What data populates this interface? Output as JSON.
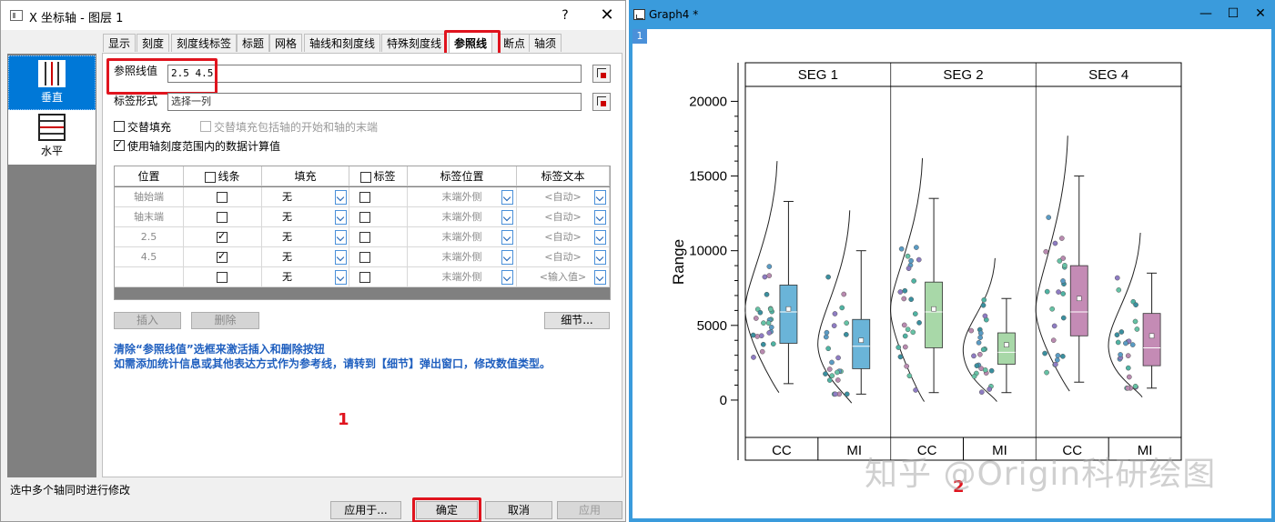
{
  "dialog": {
    "title": "X 坐标轴 - 图层 1",
    "help_label": "?",
    "close_label": "✕",
    "side_nav": [
      {
        "label": "垂直",
        "selected": true
      },
      {
        "label": "水平",
        "selected": false
      }
    ],
    "tabs": [
      "显示",
      "刻度",
      "刻度线标签",
      "标题",
      "网格",
      "轴线和刻度线",
      "特殊刻度线",
      "参照线",
      "断点",
      "轴须"
    ],
    "active_tab": "参照线",
    "ref_values_label": "参照线值",
    "ref_values_value": "2.5 4.5",
    "label_format_label": "标签形式",
    "label_format_value": "选择一列",
    "alt_fill_label": "交替填充",
    "alt_fill_include_label": "交替填充包括轴的开始和轴的末端",
    "use_tick_range_label": "使用轴刻度范围内的数据计算值",
    "table": {
      "headers": [
        "位置",
        "线条",
        "填充",
        "标签",
        "标签位置",
        "标签文本"
      ],
      "rows": [
        {
          "position": "轴始端",
          "line": false,
          "fill": "无",
          "label": false,
          "label_pos": "末端外侧",
          "label_text": "<自动>"
        },
        {
          "position": "轴末端",
          "line": false,
          "fill": "无",
          "label": false,
          "label_pos": "末端外侧",
          "label_text": "<自动>"
        },
        {
          "position": "2.5",
          "line": true,
          "fill": "无",
          "label": false,
          "label_pos": "末端外侧",
          "label_text": "<自动>"
        },
        {
          "position": "4.5",
          "line": true,
          "fill": "无",
          "label": false,
          "label_pos": "末端外侧",
          "label_text": "<自动>"
        },
        {
          "position": "",
          "line": false,
          "fill": "无",
          "label": false,
          "label_pos": "末端外侧",
          "label_text": "<输入值>"
        }
      ]
    },
    "insert_label": "插入",
    "delete_label": "删除",
    "detail_label": "细节...",
    "info_line1": "清除“参照线值”选框来激活插入和删除按钮",
    "info_line2": "如需添加统计信息或其他表达方式作为参考线，请转到【细节】弹出窗口，修改数值类型。",
    "marker1": "1",
    "status": "选中多个轴同时进行修改",
    "apply_to_label": "应用于...",
    "ok_label": "确定",
    "cancel_label": "取消",
    "apply_label": "应用"
  },
  "graph_window": {
    "title": "Graph4 *",
    "layer_badge": "1",
    "minimize": "—",
    "maximize": "☐",
    "close": "✕",
    "marker2": "2"
  },
  "watermark": "知乎 @Origin科研绘图",
  "chart_data": {
    "type": "box",
    "ylabel": "Range",
    "ylim": [
      -2500,
      21000
    ],
    "yticks": [
      0,
      5000,
      10000,
      15000,
      20000
    ],
    "panels": [
      "SEG 1",
      "SEG 2",
      "SEG 4"
    ],
    "categories": [
      "CC",
      "MI"
    ],
    "boxes": [
      {
        "panel": "SEG 1",
        "group": "CC",
        "whisker_low": 1100,
        "q1": 3800,
        "median": 5900,
        "q3": 7700,
        "whisker_high": 13300,
        "mean": 6100,
        "color": "#6ab4d8"
      },
      {
        "panel": "SEG 1",
        "group": "MI",
        "whisker_low": 400,
        "q1": 2100,
        "median": 3600,
        "q3": 5400,
        "whisker_high": 10000,
        "mean": 4000,
        "color": "#6ab4d8"
      },
      {
        "panel": "SEG 2",
        "group": "CC",
        "whisker_low": 500,
        "q1": 3500,
        "median": 5900,
        "q3": 7900,
        "whisker_high": 13500,
        "mean": 6100,
        "color": "#a8d8a8"
      },
      {
        "panel": "SEG 2",
        "group": "MI",
        "whisker_low": 500,
        "q1": 2400,
        "median": 3200,
        "q3": 4500,
        "whisker_high": 6800,
        "mean": 3700,
        "color": "#a8d8a8"
      },
      {
        "panel": "SEG 4",
        "group": "CC",
        "whisker_low": 1200,
        "q1": 4300,
        "median": 5900,
        "q3": 9000,
        "whisker_high": 15000,
        "mean": 6800,
        "color": "#c48bb5"
      },
      {
        "panel": "SEG 4",
        "group": "MI",
        "whisker_low": 800,
        "q1": 2300,
        "median": 3500,
        "q3": 5800,
        "whisker_high": 8500,
        "mean": 4300,
        "color": "#c48bb5"
      }
    ]
  }
}
